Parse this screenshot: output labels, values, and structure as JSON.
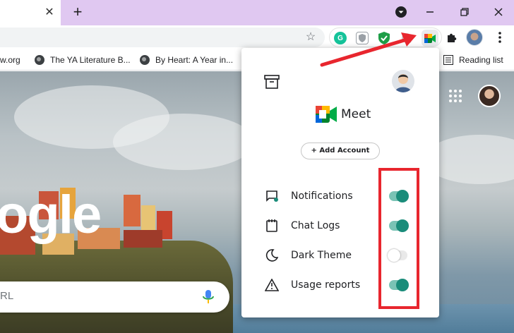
{
  "tabs": {
    "close_glyph": "✕",
    "new_tab_glyph": "+"
  },
  "toolbar": {
    "extensions": [
      {
        "name": "grammarly-icon",
        "letter": "G",
        "color": "#15c39a"
      },
      {
        "name": "shield-extension-icon",
        "letter": "",
        "color": "#9aa0a6"
      },
      {
        "name": "green-shield-extension-icon",
        "letter": "",
        "color": "#1e9e47"
      },
      {
        "name": "meet-extension-icon",
        "letter": "",
        "color": "#e8eaed"
      }
    ]
  },
  "bookmarks": {
    "items": [
      {
        "label": "w.org"
      },
      {
        "label": "The YA Literature B..."
      },
      {
        "label": "By Heart: A Year in..."
      }
    ],
    "reading_list": "Reading list"
  },
  "ntp": {
    "logo_partial": "ogle",
    "search_placeholder": "RL"
  },
  "popup": {
    "app_name": "Meet",
    "add_account": "+ Add Account",
    "settings": [
      {
        "label": "Notifications",
        "enabled": true
      },
      {
        "label": "Chat Logs",
        "enabled": true
      },
      {
        "label": "Dark Theme",
        "enabled": false
      },
      {
        "label": "Usage reports",
        "enabled": true
      }
    ]
  },
  "colors": {
    "tabstrip": "#e0c8f1",
    "toggle_on": "#1a8c7a",
    "annotation_red": "#e8262e"
  }
}
